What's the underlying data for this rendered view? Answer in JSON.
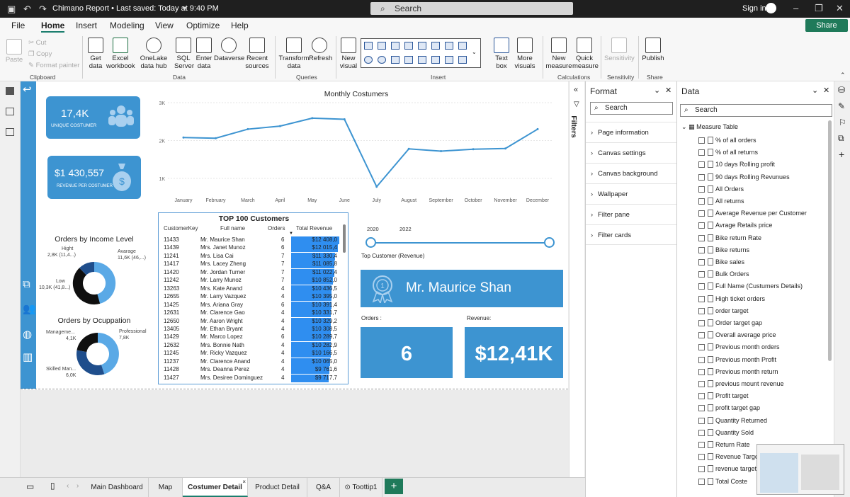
{
  "titlebar": {
    "title": "Chimano Report • Last saved: Today at 9:40 PM",
    "search": "Search",
    "signin": "Sign in"
  },
  "menu": [
    "File",
    "Home",
    "Insert",
    "Modeling",
    "View",
    "Optimize",
    "Help"
  ],
  "share": "Share",
  "ribbon": {
    "clipboard": {
      "paste": "Paste",
      "cut": "Cut",
      "copy": "Copy",
      "format_painter": "Format painter",
      "group": "Clipboard"
    },
    "data": {
      "get_data": "Get data",
      "excel": "Excel workbook",
      "onelake": "OneLake data hub",
      "sql": "SQL Server",
      "enter": "Enter data",
      "dataverse": "Dataverse",
      "recent": "Recent sources",
      "group": "Data"
    },
    "queries": {
      "transform": "Transform data",
      "refresh": "Refresh",
      "group": "Queries"
    },
    "insert": {
      "new_visual": "New visual",
      "text_box": "Text box",
      "more_visuals": "More visuals",
      "group": "Insert"
    },
    "calculations": {
      "new_measure": "New measure",
      "quick_measure": "Quick measure",
      "group": "Calculations"
    },
    "sensitivity": {
      "label": "Sensitivity",
      "group": "Sensitivity"
    },
    "share": {
      "publish": "Publish",
      "group": "Share"
    }
  },
  "kpis": {
    "unique_value": "17,4K",
    "unique_label": "UNIQUE COSTUMER",
    "revenue_value": "$1 430,557",
    "revenue_label": "REVENUE PER COSTUMER"
  },
  "monthly": {
    "title": "Monthly Costumers"
  },
  "chart_data": {
    "type": "line",
    "title": "Monthly Costumers",
    "categories": [
      "January",
      "February",
      "March",
      "April",
      "May",
      "June",
      "July",
      "August",
      "September",
      "October",
      "November",
      "December"
    ],
    "values": [
      2080,
      2060,
      2300,
      2380,
      2590,
      2560,
      780,
      1780,
      1720,
      1770,
      1790,
      2300
    ],
    "yticks": [
      "1K",
      "2K",
      "3K"
    ],
    "ylim": [
      700,
      3000
    ],
    "grid": true
  },
  "income": {
    "title": "Orders by Income Level",
    "hight": "Hight",
    "hight_val": "2,8K (11,4...)",
    "avarage": "Avarage",
    "avarage_val": "11,6K (46,...)",
    "low": "Low",
    "low_val": "10,3K (41,8...)"
  },
  "occupation": {
    "title": "Orders by Ocuppation",
    "management": "Manageme...",
    "management_val": "4,1K",
    "professional": "Professional",
    "professional_val": "7,8K",
    "skilled": "Skilled Man...",
    "skilled_val": "6,0K"
  },
  "top100": {
    "title": "TOP 100 Customers",
    "headers": [
      "CustomerKey",
      "Full name",
      "Orders",
      "Total Revenue"
    ],
    "rows": [
      {
        "key": "11433",
        "name": "Mr. Maurice Shan",
        "orders": "6",
        "revenue": "$12 408,0",
        "frac": 1.0
      },
      {
        "key": "11439",
        "name": "Mrs. Janet Munoz",
        "orders": "6",
        "revenue": "$12 015,4",
        "frac": 0.97
      },
      {
        "key": "11241",
        "name": "Mrs. Lisa Cai",
        "orders": "7",
        "revenue": "$11 330,4",
        "frac": 0.91
      },
      {
        "key": "11417",
        "name": "Mrs. Lacey Zheng",
        "orders": "7",
        "revenue": "$11 085,8",
        "frac": 0.89
      },
      {
        "key": "11420",
        "name": "Mr. Jordan Turner",
        "orders": "7",
        "revenue": "$11 022,4",
        "frac": 0.89
      },
      {
        "key": "11242",
        "name": "Mr. Larry Munoz",
        "orders": "7",
        "revenue": "$10 852,0",
        "frac": 0.87
      },
      {
        "key": "13263",
        "name": "Mrs. Kate Anand",
        "orders": "4",
        "revenue": "$10 436,5",
        "frac": 0.84
      },
      {
        "key": "12655",
        "name": "Mr. Larry Vazquez",
        "orders": "4",
        "revenue": "$10 395,0",
        "frac": 0.84
      },
      {
        "key": "11425",
        "name": "Mrs. Ariana Gray",
        "orders": "6",
        "revenue": "$10 391,4",
        "frac": 0.84
      },
      {
        "key": "12631",
        "name": "Mr. Clarence Gao",
        "orders": "4",
        "revenue": "$10 331,7",
        "frac": 0.83
      },
      {
        "key": "12650",
        "name": "Mr. Aaron Wright",
        "orders": "4",
        "revenue": "$10 329,2",
        "frac": 0.83
      },
      {
        "key": "13405",
        "name": "Mr. Ethan Bryant",
        "orders": "4",
        "revenue": "$10 308,5",
        "frac": 0.83
      },
      {
        "key": "11429",
        "name": "Mr. Marco Lopez",
        "orders": "6",
        "revenue": "$10 289,7",
        "frac": 0.83
      },
      {
        "key": "12632",
        "name": "Mrs. Bonnie Nath",
        "orders": "4",
        "revenue": "$10 282,9",
        "frac": 0.83
      },
      {
        "key": "11245",
        "name": "Mr. Ricky Vazquez",
        "orders": "4",
        "revenue": "$10 166,5",
        "frac": 0.82
      },
      {
        "key": "11237",
        "name": "Mr. Clarence Anand",
        "orders": "4",
        "revenue": "$10 065,0",
        "frac": 0.81
      },
      {
        "key": "11428",
        "name": "Mrs. Deanna Perez",
        "orders": "4",
        "revenue": "$9 761,6",
        "frac": 0.79
      },
      {
        "key": "11427",
        "name": "Mrs. Desiree Dominguez",
        "orders": "4",
        "revenue": "$9 717,7",
        "frac": 0.78
      }
    ]
  },
  "slider": {
    "from": "2020",
    "to": "2022"
  },
  "topcustomer": {
    "label": "Top Customer (Revenue)",
    "name": "Mr. Maurice Shan",
    "orders_label": "Orders :",
    "orders": "6",
    "revenue_label": "Revenue:",
    "revenue": "$12,41K"
  },
  "format": {
    "title": "Format",
    "search": "Search",
    "sections": [
      "Page information",
      "Canvas settings",
      "Canvas background",
      "Wallpaper",
      "Filter pane",
      "Filter cards"
    ]
  },
  "filters": "Filters",
  "data": {
    "title": "Data",
    "search": "Search",
    "table": "Measure Table",
    "items": [
      "% of all orders",
      "% of all returns",
      "10 days Rolling profit",
      "90 days Rolling Revunues",
      "All Orders",
      "All returns",
      "Average Revenue per Customer",
      "Avrage Retails price",
      "Bike return Rate",
      "Bike returns",
      "Bike sales",
      "Bulk Orders",
      "Full Name (Custumers Details)",
      "High ticket orders",
      "order target",
      "Order target gap",
      "Overall average price",
      "Previous month orders",
      "Previous month Profit",
      "Previous month return",
      "previous mount revenue",
      "Profit target",
      "profit target gap",
      "Quantity Returned",
      "Quantity Sold",
      "Return Rate",
      "Revenue Target",
      "revenue target",
      "Total Coste"
    ]
  },
  "tabs": [
    "Main Dashboard",
    "Map",
    "Costumer Detail",
    "Product Detail",
    "Q&A",
    "Toottip1"
  ]
}
